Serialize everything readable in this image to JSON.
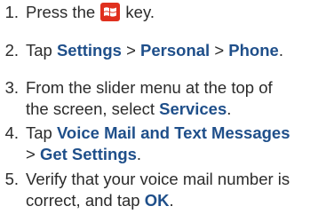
{
  "steps": [
    {
      "number": "1.",
      "parts": {
        "a": "Press the ",
        "b": " key."
      },
      "icon": "windows-flag-icon",
      "icon_color": "#e0301e"
    },
    {
      "number": "2.",
      "parts": {
        "a": "Tap ",
        "b": "Settings",
        "c": " > ",
        "d": "Personal",
        "e": " > ",
        "f": "Phone",
        "g": "."
      }
    },
    {
      "number": "3.",
      "parts": {
        "a": "From the slider menu at the top of",
        "b": "the screen, select ",
        "c": "Services",
        "d": "."
      }
    },
    {
      "number": "4.",
      "parts": {
        "a": "Tap ",
        "b": "Voice Mail and Text Messages",
        "c": "> ",
        "d": "Get Settings",
        "e": "."
      }
    },
    {
      "number": "5.",
      "parts": {
        "a": "Verify that your voice mail number is",
        "b": "correct, and tap ",
        "c": "OK",
        "d": "."
      }
    }
  ],
  "colors": {
    "text": "#2b2b2b",
    "keyword": "#1f4f8a"
  }
}
